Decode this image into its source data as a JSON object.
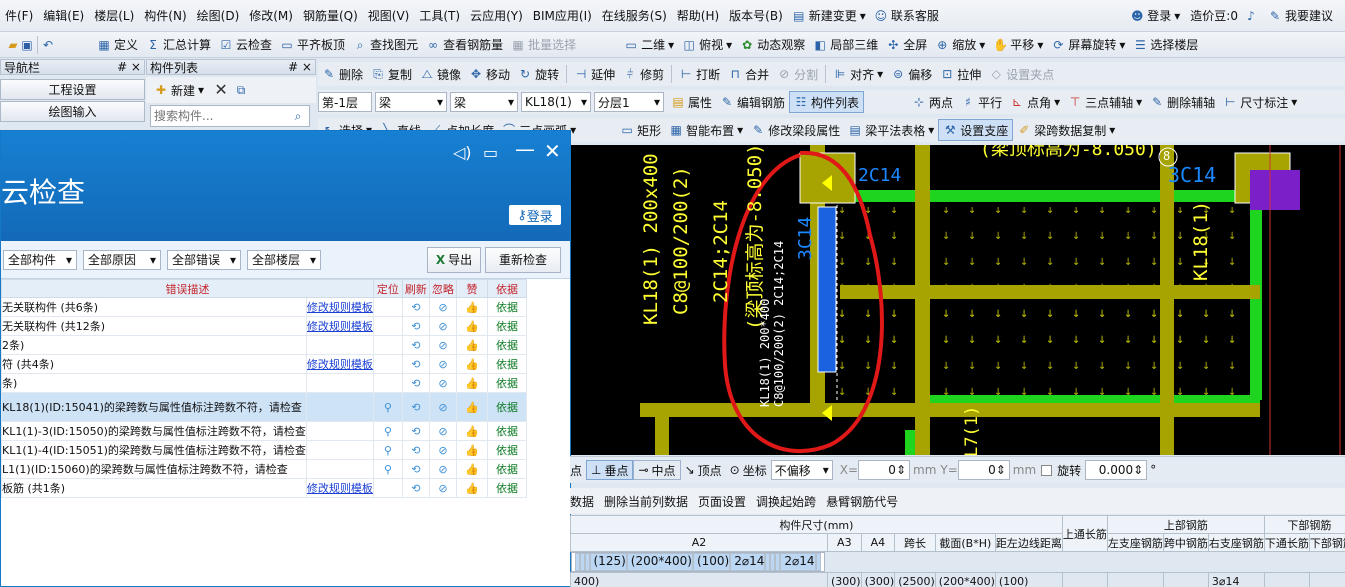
{
  "menu": {
    "items": [
      "件(F)",
      "编辑(E)",
      "楼层(L)",
      "构件(N)",
      "绘图(D)",
      "修改(M)",
      "钢筋量(Q)",
      "视图(V)",
      "工具(T)",
      "云应用(Y)",
      "BIM应用(I)",
      "在线服务(S)",
      "帮助(H)",
      "版本号(B)"
    ],
    "new_change": "新建变更",
    "contact": "联系客服",
    "login": "登录",
    "beans": "造价豆:0",
    "suggest": "我要建议"
  },
  "toolbar1": {
    "define": "定义",
    "sum_calc": "汇总计算",
    "cloud_check": "云检查",
    "flat_top": "平齐板顶",
    "find_elem": "查找图元",
    "view_rebar": "查看钢筋量",
    "batch_select": "批量选择",
    "view_2d": "二维",
    "top_view": "俯视",
    "dyn_observe": "动态观察",
    "local_3d": "局部三维",
    "fullscreen": "全屏",
    "zoom": "缩放",
    "pan": "平移",
    "screen_rotate": "屏幕旋转",
    "select_floor": "选择楼层"
  },
  "toolbar2": {
    "delete": "删除",
    "copy": "复制",
    "mirror": "镜像",
    "move": "移动",
    "rotate": "旋转",
    "extend": "延伸",
    "trim": "修剪",
    "break": "打断",
    "merge": "合并",
    "split": "分割",
    "align": "对齐",
    "offset": "偏移",
    "stretch": "拉伸",
    "set_grip": "设置夹点"
  },
  "toolbar3": {
    "floor": "第-1层",
    "type1": "梁",
    "type2": "梁",
    "component": "KL18(1)",
    "layer": "分层1",
    "property": "属性",
    "edit_rebar": "编辑钢筋",
    "component_list": "构件列表",
    "two_points": "两点",
    "parallel": "平行",
    "point_angle": "点角",
    "three_point_axis": "三点辅轴",
    "delete_axis": "删除辅轴",
    "dim": "尺寸标注"
  },
  "toolbar4": {
    "select": "选择",
    "line": "直线",
    "point_extend": "点加长度",
    "three_arc": "三点画弧",
    "rect": "矩形",
    "smart_layout": "智能布置",
    "modify_span": "修改梁段属性",
    "beam_table": "梁平法表格",
    "set_support": "设置支座",
    "span_copy": "梁跨数据复制"
  },
  "left": {
    "nav_title": "导航栏",
    "nav_pin": "# ×",
    "project_settings": "工程设置",
    "draw_input": "绘图输入",
    "comp_list_title": "构件列表",
    "comp_pin": "# ×",
    "new_btn": "新建",
    "search_placeholder": "搜索构件..."
  },
  "dialog": {
    "title": "云检查",
    "login": "登录",
    "filters": [
      "全部构件",
      "全部原因",
      "全部错误",
      "全部楼层"
    ],
    "export": "导出",
    "recheck": "重新检查",
    "columns": [
      "错误描述",
      "定位",
      "刷新",
      "忽略",
      "赞",
      "依据"
    ],
    "rows": [
      {
        "desc": "无关联构件 (共6条)",
        "link": "修改规则模板",
        "locate": false,
        "basis": "依据",
        "hl": false
      },
      {
        "desc": "无关联构件 (共12条)",
        "link": "修改规则模板",
        "locate": false,
        "basis": "依据",
        "hl": false
      },
      {
        "desc": "2条)",
        "link": "",
        "locate": false,
        "basis": "依据",
        "hl": false
      },
      {
        "desc": "符 (共4条)",
        "link": "修改规则模板",
        "locate": false,
        "basis": "依据",
        "hl": false
      },
      {
        "desc": "条)",
        "link": "",
        "locate": false,
        "basis": "依据",
        "hl": false
      },
      {
        "desc": "KL18(1)(ID:15041)的梁跨数与属性值标注跨数不符，请检查",
        "link": "",
        "locate": true,
        "basis": "依据",
        "hl": true
      },
      {
        "desc": "KL1(1)-3(ID:15050)的梁跨数与属性值标注跨数不符，请检查",
        "link": "",
        "locate": true,
        "basis": "依据",
        "hl": false
      },
      {
        "desc": "KL1(1)-4(ID:15051)的梁跨数与属性值标注跨数不符，请检查",
        "link": "",
        "locate": true,
        "basis": "依据",
        "hl": false
      },
      {
        "desc": "L1(1)(ID:15060)的梁跨数与属性值标注跨数不符，请检查",
        "link": "",
        "locate": true,
        "basis": "依据",
        "hl": false
      },
      {
        "desc": "板筋 (共1条)",
        "link": "修改规则模板",
        "locate": false,
        "basis": "依据",
        "hl": false
      }
    ]
  },
  "cad": {
    "label_kl18_left_1": "KL18(1) 200x400",
    "label_kl18_left_2": "C8@100/200(2)",
    "label_kl18_left_3": "2C14;2C14",
    "label_top_elev": "(梁顶标高为-8.050)",
    "label_3c14_left": "3C14",
    "label_3c14_top": "3C14",
    "label_2c14_top": "2C14",
    "label_small_1": "KL18(1) 200*400",
    "label_small_2": "C8@100/200(2) 2C14;2C14",
    "label_kl18_right": "KL18(1)",
    "label_l7": "L7(1)",
    "label_top_right": "(梁顶标高为-8.050)",
    "axis_8": "8"
  },
  "snap": {
    "point": "点",
    "perp": "垂点",
    "mid": "中点",
    "vertex": "顶点",
    "coord": "坐标",
    "no_offset": "不偏移",
    "x_label": "X=",
    "x_val": "0",
    "y_label": "Y=",
    "y_val": "0",
    "mm1": "mm",
    "mm2": "mm",
    "rotate": "旋转",
    "rotate_val": "0.000",
    "deg": "°"
  },
  "grid_toolbar": {
    "data": "数据",
    "del_col": "删除当前列数据",
    "page_setup": "页面设置",
    "adjust_span": "调换起始跨",
    "cantilever": "悬臂钢筋代号"
  },
  "grid": {
    "group_size": "构件尺寸(mm)",
    "top_through": "上通长筋",
    "group_top": "上部钢筋",
    "group_bottom": "下部钢筋",
    "cols": [
      "A2",
      "A3",
      "A4",
      "跨长",
      "截面(B*H)",
      "距左边线距离"
    ],
    "top_cols": [
      "左支座钢筋",
      "跨中钢筋",
      "右支座钢筋"
    ],
    "bottom_cols": [
      "下通长筋",
      "下部钢筋"
    ],
    "row1": [
      "",
      "",
      "",
      "(125)",
      "(200*400)",
      "(100)",
      "2⌀14",
      "",
      "",
      "",
      "2⌀14",
      ""
    ],
    "row2": [
      "400)",
      "(300)",
      "(300)",
      "(2500)",
      "(200*400)",
      "(100)",
      "",
      "",
      "",
      "3⌀14",
      "",
      ""
    ]
  }
}
